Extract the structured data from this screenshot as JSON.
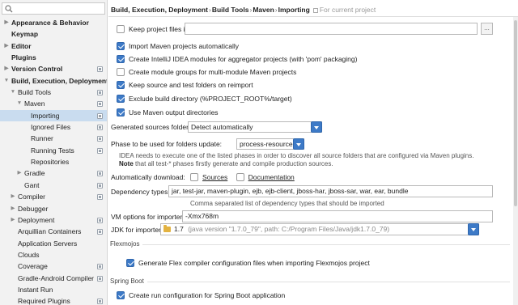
{
  "sidebar": {
    "search_value": "",
    "items": [
      {
        "label": "Appearance & Behavior",
        "indent": 0,
        "arrow": "right",
        "bold": true,
        "proj": false
      },
      {
        "label": "Keymap",
        "indent": 0,
        "arrow": "",
        "bold": true,
        "proj": false
      },
      {
        "label": "Editor",
        "indent": 0,
        "arrow": "right",
        "bold": true,
        "proj": false
      },
      {
        "label": "Plugins",
        "indent": 0,
        "arrow": "",
        "bold": true,
        "proj": false
      },
      {
        "label": "Version Control",
        "indent": 0,
        "arrow": "right",
        "bold": true,
        "proj": true
      },
      {
        "label": "Build, Execution, Deployment",
        "indent": 0,
        "arrow": "down",
        "bold": true,
        "proj": false
      },
      {
        "label": "Build Tools",
        "indent": 1,
        "arrow": "down",
        "bold": false,
        "proj": true
      },
      {
        "label": "Maven",
        "indent": 2,
        "arrow": "down",
        "bold": false,
        "proj": true
      },
      {
        "label": "Importing",
        "indent": 3,
        "arrow": "",
        "bold": false,
        "proj": true,
        "selected": true
      },
      {
        "label": "Ignored Files",
        "indent": 3,
        "arrow": "",
        "bold": false,
        "proj": true
      },
      {
        "label": "Runner",
        "indent": 3,
        "arrow": "",
        "bold": false,
        "proj": true
      },
      {
        "label": "Running Tests",
        "indent": 3,
        "arrow": "",
        "bold": false,
        "proj": true
      },
      {
        "label": "Repositories",
        "indent": 3,
        "arrow": "",
        "bold": false,
        "proj": false
      },
      {
        "label": "Gradle",
        "indent": 2,
        "arrow": "right",
        "bold": false,
        "proj": true
      },
      {
        "label": "Gant",
        "indent": 2,
        "arrow": "",
        "bold": false,
        "proj": true
      },
      {
        "label": "Compiler",
        "indent": 1,
        "arrow": "right",
        "bold": false,
        "proj": true
      },
      {
        "label": "Debugger",
        "indent": 1,
        "arrow": "right",
        "bold": false,
        "proj": false
      },
      {
        "label": "Deployment",
        "indent": 1,
        "arrow": "right",
        "bold": false,
        "proj": true
      },
      {
        "label": "Arquillian Containers",
        "indent": 1,
        "arrow": "",
        "bold": false,
        "proj": true
      },
      {
        "label": "Application Servers",
        "indent": 1,
        "arrow": "",
        "bold": false,
        "proj": false
      },
      {
        "label": "Clouds",
        "indent": 1,
        "arrow": "",
        "bold": false,
        "proj": false
      },
      {
        "label": "Coverage",
        "indent": 1,
        "arrow": "",
        "bold": false,
        "proj": true
      },
      {
        "label": "Gradle-Android Compiler",
        "indent": 1,
        "arrow": "",
        "bold": false,
        "proj": true
      },
      {
        "label": "Instant Run",
        "indent": 1,
        "arrow": "",
        "bold": false,
        "proj": false
      },
      {
        "label": "Required Plugins",
        "indent": 1,
        "arrow": "",
        "bold": false,
        "proj": true
      }
    ]
  },
  "breadcrumb": {
    "parts": [
      "Build, Execution, Deployment",
      "Build Tools",
      "Maven",
      "Importing"
    ],
    "separator": "›",
    "note": "For current project"
  },
  "settings": {
    "keep_project_files_label": "Keep project files in:",
    "keep_project_files_checked": false,
    "keep_project_files_value": "",
    "browse_label": "...",
    "import_auto_label": "Import Maven projects automatically",
    "import_auto_checked": true,
    "create_modules_label": "Create IntelliJ IDEA modules for aggregator projects (with 'pom' packaging)",
    "create_modules_checked": true,
    "module_groups_label": "Create module groups for multi-module Maven projects",
    "module_groups_checked": false,
    "keep_source_label": "Keep source and test folders on reimport",
    "keep_source_checked": true,
    "exclude_build_label": "Exclude build directory (%PROJECT_ROOT%/target)",
    "exclude_build_checked": true,
    "use_output_label": "Use Maven output directories",
    "use_output_checked": true,
    "gen_sources_label": "Generated sources folders:",
    "gen_sources_value": "Detect automatically",
    "phase_label": "Phase to be used for folders update:",
    "phase_value": "process-resources",
    "phase_hint_1": "IDEA needs to execute one of the listed phases in order to discover all source folders that are configured via Maven plugins.",
    "phase_hint_note": "Note",
    "phase_hint_2": " that all test-* phases firstly generate and compile production sources.",
    "auto_download_label": "Automatically download:",
    "sources_label": "Sources",
    "sources_checked": false,
    "documentation_label": "Documentation",
    "documentation_checked": false,
    "dep_types_label": "Dependency types:",
    "dep_types_value": "jar, test-jar, maven-plugin, ejb, ejb-client, jboss-har, jboss-sar, war, ear, bundle",
    "dep_types_hint": "Comma separated list of dependency types that should be imported",
    "vm_options_label": "VM options for importer:",
    "vm_options_value": "-Xmx768m",
    "jdk_label": "JDK for importer:",
    "jdk_value": "1.7",
    "jdk_detail": "(java version \"1.7.0_79\", path: C:/Program Files/Java/jdk1.7.0_79)",
    "flexmojos_section": "Flexmojos",
    "flex_config_label": "Generate Flex compiler configuration files when importing Flexmojos project",
    "flex_config_checked": true,
    "spring_boot_section": "Spring Boot",
    "spring_run_label": "Create run configuration for Spring Boot application",
    "spring_run_checked": true
  },
  "colors": {
    "accent": "#3d7ac7",
    "selection": "#c9dcef"
  }
}
